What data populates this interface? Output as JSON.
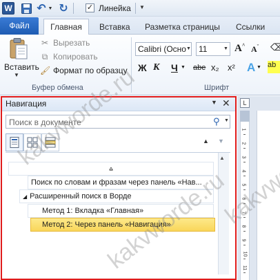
{
  "qat": {
    "app_letter": "W",
    "ruler_checked": "✓",
    "ruler_label": "Линейка"
  },
  "tabs": {
    "file": "Файл",
    "home": "Главная",
    "insert": "Вставка",
    "layout": "Разметка страницы",
    "links": "Ссылки"
  },
  "ribbon": {
    "clipboard": {
      "paste": "Вставить",
      "cut": "Вырезать",
      "copy": "Копировать",
      "format_painter": "Формат по образцу",
      "group": "Буфер обмена"
    },
    "font": {
      "family": "Calibri (Осно",
      "size": "11",
      "grow": "A",
      "shrink": "A",
      "bold": "Ж",
      "italic": "К",
      "underline": "Ч",
      "strike": "abe",
      "subscript": "x₂",
      "superscript": "x²",
      "effects": "A",
      "highlight": "ab",
      "group": "Шрифт"
    }
  },
  "navigation": {
    "title": "Навигация",
    "search_placeholder": "Поиск в документе",
    "tree": [
      {
        "label": "Поиск по словам и фразам через панель «Нав..."
      },
      {
        "label": "Расширенный поиск в Ворде"
      },
      {
        "label": "Метод 1: Вкладка «Главная»"
      },
      {
        "label": "Метод 2: Через панель «Навигация»",
        "selected": true
      }
    ]
  },
  "ruler": {
    "marks": [
      "1",
      "2",
      "3",
      "4",
      "5",
      "6",
      "7",
      "8",
      "9",
      "10",
      "11"
    ]
  },
  "watermark": {
    "text": "kakvworde.ru"
  },
  "colors": {
    "highlight_frame": "#e01b1b",
    "file_tab": "#1e5cb3",
    "selected_node": "#f9d65a"
  }
}
